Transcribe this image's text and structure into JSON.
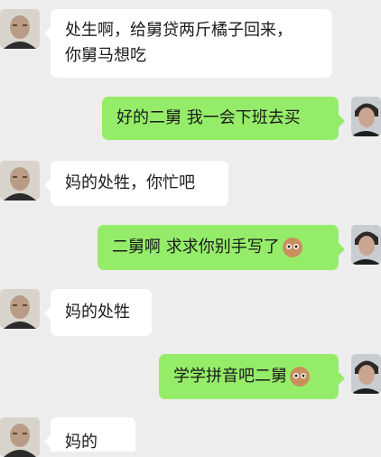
{
  "messages": [
    {
      "side": "in",
      "lines": [
        "处生啊，给舅贷两斤橘子回来，",
        "你舅马想吃"
      ]
    },
    {
      "side": "out",
      "text": "好的二舅 我一会下班去买"
    },
    {
      "side": "in",
      "text": "妈的处牲，你忙吧"
    },
    {
      "side": "out",
      "text": "二舅啊 求求你别手写了",
      "emoji": "face-icon"
    },
    {
      "side": "in",
      "text": "妈的处牲"
    },
    {
      "side": "out",
      "text": "学学拼音吧二舅",
      "emoji": "face-icon"
    },
    {
      "side": "in",
      "text": "妈的"
    }
  ],
  "colors": {
    "background": "#ededed",
    "incoming_bubble": "#ffffff",
    "outgoing_bubble": "#95ec69"
  }
}
